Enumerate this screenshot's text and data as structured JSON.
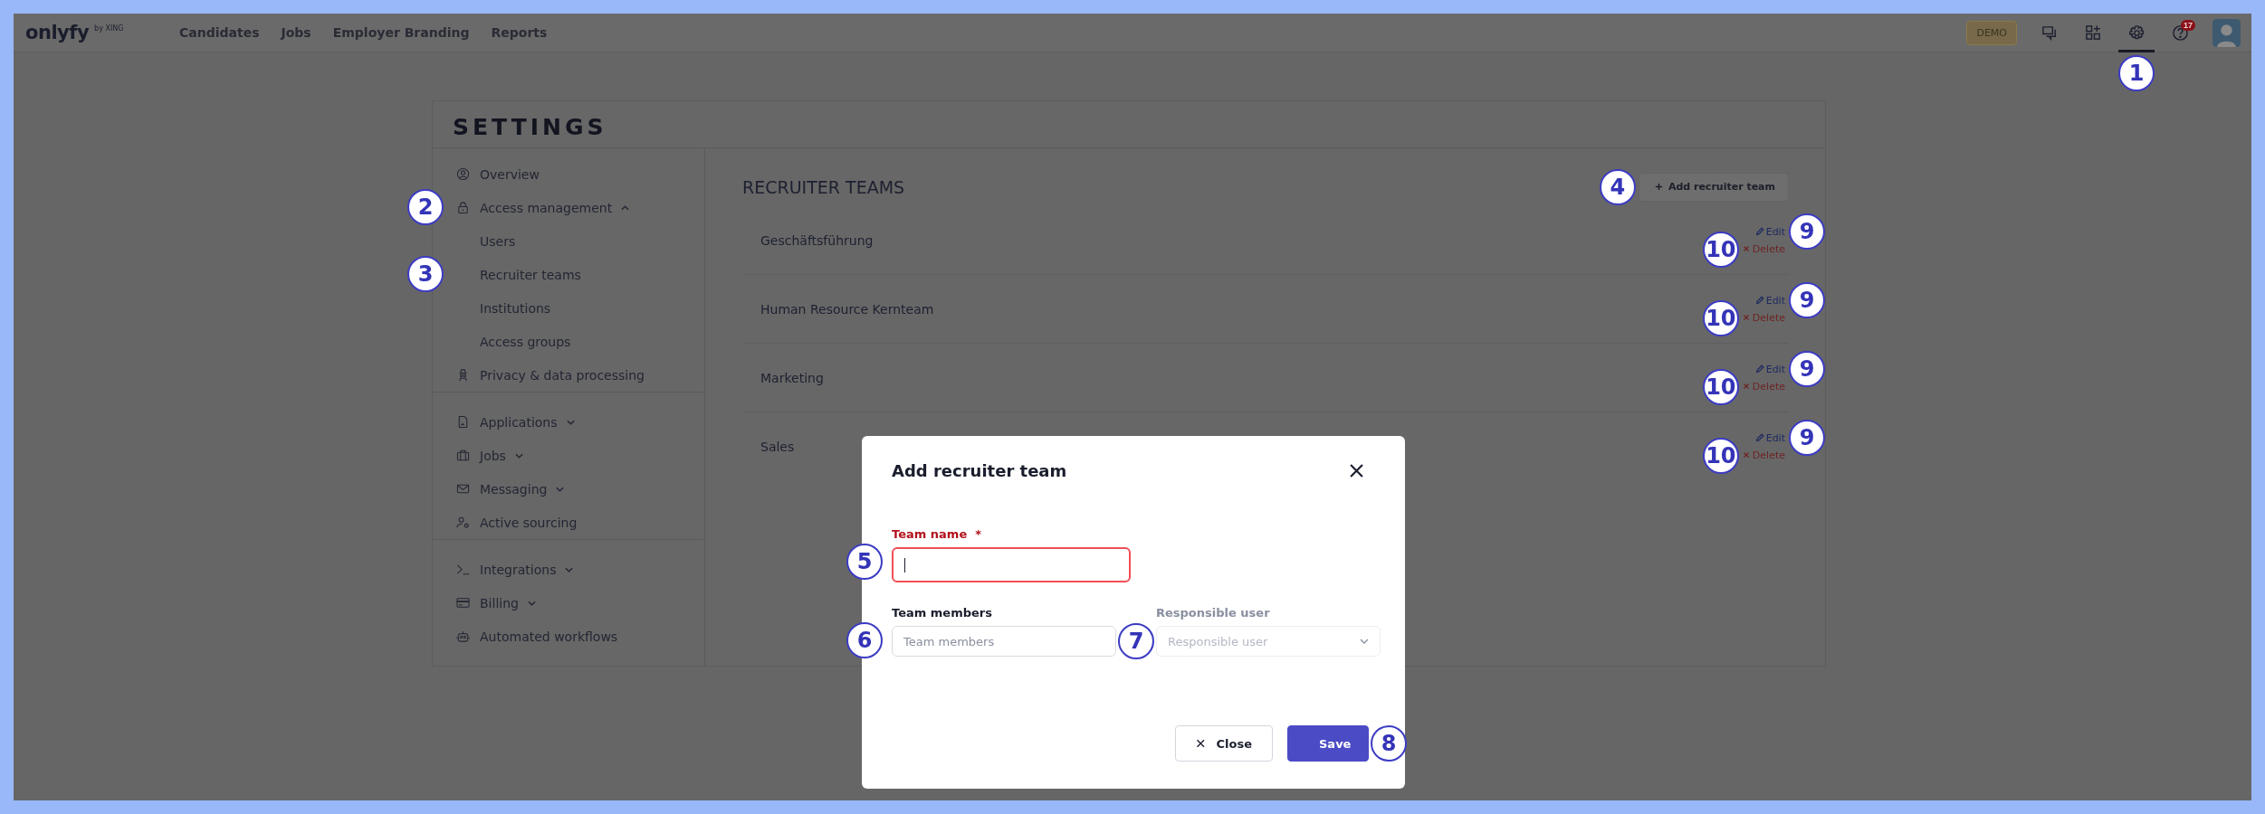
{
  "top_bar": {
    "logo": "onlyfy",
    "logo_suffix": "by XING",
    "nav": [
      "Candidates",
      "Jobs",
      "Employer Branding",
      "Reports"
    ],
    "badge": "DEMO",
    "icons": [
      {
        "kind": "chat",
        "selected": false
      },
      {
        "kind": "apps",
        "selected": false
      },
      {
        "kind": "settings",
        "selected": true,
        "callout": "1"
      },
      {
        "kind": "help",
        "selected": false,
        "badge": "17"
      }
    ]
  },
  "settings": {
    "title": "SETTINGS",
    "sidebar": [
      [
        {
          "label": "Overview"
        },
        {
          "label": "Access management",
          "expanded": true,
          "callout": "2",
          "children": [
            {
              "label": "Users"
            },
            {
              "label": "Recruiter teams",
              "callout": "3"
            },
            {
              "label": "Institutions"
            },
            {
              "label": "Access groups"
            }
          ]
        },
        {
          "label": "Privacy & data processing"
        }
      ],
      [
        {
          "label": "Applications",
          "expanded": false
        },
        {
          "label": "Jobs",
          "expanded": false
        },
        {
          "label": "Messaging",
          "expanded": false
        },
        {
          "label": "Active sourcing"
        }
      ],
      [
        {
          "label": "Integrations",
          "expanded": false
        },
        {
          "label": "Billing",
          "expanded": false
        },
        {
          "label": "Automated workflows"
        }
      ]
    ],
    "content": {
      "title": "RECRUITER TEAMS",
      "add_button": {
        "label": "Add recruiter team",
        "callout": "4"
      },
      "teams": [
        {
          "name": "Geschäftsführung",
          "edit": "Edit",
          "delete": "Delete",
          "edit_callout": "9",
          "delete_callout": "10"
        },
        {
          "name": "Human Resource Kernteam",
          "edit": "Edit",
          "delete": "Delete",
          "edit_callout": "9",
          "delete_callout": "10"
        },
        {
          "name": "Marketing",
          "edit": "Edit",
          "delete": "Delete",
          "edit_callout": "9",
          "delete_callout": "10"
        },
        {
          "name": "Sales",
          "edit": "Edit",
          "delete": "Delete",
          "edit_callout": "9",
          "delete_callout": "10"
        }
      ]
    }
  },
  "modal": {
    "title": "Add recruiter team",
    "fields": [
      {
        "kind": "text",
        "label": "Team name",
        "required_mark": "*",
        "invalid": true,
        "focused": true,
        "callout": "5"
      },
      {
        "kind": "text",
        "label": "Team members",
        "placeholder": "Team members",
        "callout": "6"
      },
      {
        "kind": "select",
        "label": "Responsible user",
        "placeholder": "Responsible user",
        "disabled": true,
        "callout": "7"
      }
    ],
    "buttons": [
      {
        "kind": "secondary",
        "label": "Close"
      },
      {
        "kind": "primary",
        "label": "Save",
        "callout": "8"
      }
    ]
  }
}
